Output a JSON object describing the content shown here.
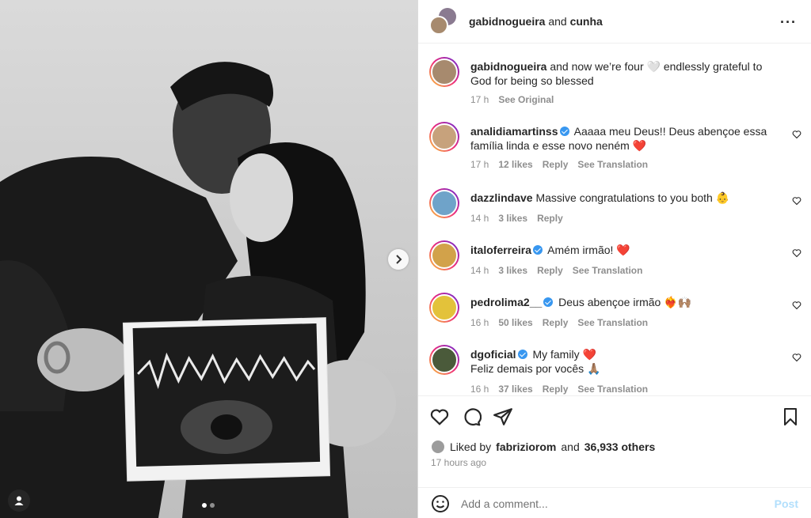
{
  "media": {
    "user_tag_icon": "person-icon",
    "next_icon": "chevron-right-icon",
    "carousel_index": 1,
    "carousel_total": 2
  },
  "header": {
    "author": "gabidnogueira",
    "connector": "and",
    "coauthor": "cunha",
    "more_icon": "more-horizontal-icon"
  },
  "caption": {
    "username": "gabidnogueira",
    "text": "and now we’re four 🤍 endlessly grateful to God for being so blessed",
    "time": "17 h",
    "see_original": "See Original"
  },
  "comments": [
    {
      "username": "analidiamartinss",
      "verified": true,
      "text": "Aaaaa meu Deus!! Deus abençoe essa família linda e esse novo neném ❤️",
      "time": "17 h",
      "likes": "12 likes",
      "reply": "Reply",
      "translate": "See Translation",
      "avatar_color": "#c7a27c"
    },
    {
      "username": "dazzlindave",
      "verified": false,
      "text": "Massive congratulations to you both 👶",
      "time": "14 h",
      "likes": "3 likes",
      "reply": "Reply",
      "translate": "",
      "avatar_color": "#6fa3c9"
    },
    {
      "username": "italoferreira",
      "verified": true,
      "text": "Amém irmão! ❤️",
      "time": "14 h",
      "likes": "3 likes",
      "reply": "Reply",
      "translate": "See Translation",
      "avatar_color": "#d2a24a"
    },
    {
      "username": "pedrolima2__",
      "verified": true,
      "text": "Deus abençoe irmão ❤️‍🔥🙌🏽",
      "time": "16 h",
      "likes": "50 likes",
      "reply": "Reply",
      "translate": "See Translation",
      "avatar_color": "#e3c23a"
    },
    {
      "username": "dgoficial",
      "verified": true,
      "text": "My family ❤️",
      "text2": "Feliz demais por vocês 🙏🏽",
      "time": "16 h",
      "likes": "37 likes",
      "reply": "Reply",
      "translate": "See Translation",
      "avatar_color": "#4a5a3a"
    }
  ],
  "actions": {
    "like_icon": "heart-icon",
    "comment_icon": "comment-icon",
    "share_icon": "share-icon",
    "save_icon": "bookmark-icon",
    "liked_by_prefix": "Liked by",
    "liked_by_user": "fabriziorom",
    "liked_by_and": "and",
    "liked_by_others": "36,933 others",
    "time_ago": "17 hours ago"
  },
  "composer": {
    "emoji_icon": "smiley-icon",
    "placeholder": "Add a comment...",
    "post_label": "Post"
  }
}
